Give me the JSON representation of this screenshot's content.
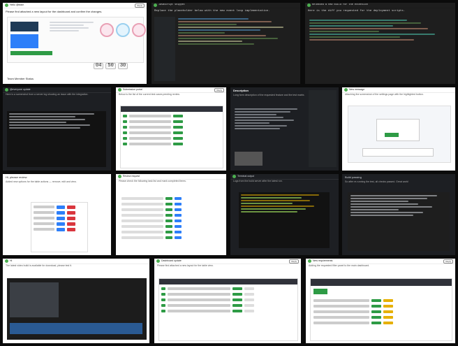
{
  "tiles": [
    {
      "title": "Hello @team",
      "sub": "Please find attached a new layout for the dashboard and confirm the changes."
    },
    {
      "title": "JavaScript snippet",
      "sub": "Replace the placeholder below with the new event loop implementation."
    },
    {
      "title": "Released a new build for the extension",
      "sub": "Here is the diff you requested for the deployment scripts."
    },
    {
      "title": "@everyone update",
      "sub": "Here is a screenshot from a server log showing an issue with the integration."
    },
    {
      "title": "Submission portal",
      "sub": "Below is the list of the current test cases pending review."
    },
    {
      "title": "Description",
      "sub": "Long form description of the requested feature and the test matrix."
    },
    {
      "title": "New message",
      "sub": "Attaching the screenshot of the settings page with the highlighted button."
    },
    {
      "title": "Hi, please review",
      "sub": "Added new options for the table actions — remove, edit and view."
    },
    {
      "title": "Review request",
      "sub": "Please check the following task list and mark completed items."
    },
    {
      "title": "Terminal output",
      "sub": "Logs from the build server after the latest run."
    },
    {
      "title": "Build passing",
      "sub": "So after re-running the test, all checks passed. Great work!"
    },
    {
      "title": "Hi",
      "sub": "The latest video build is available for download, please test it."
    },
    {
      "title": "Dashboard update",
      "sub": "Please find attached a new layout for the table view."
    },
    {
      "title": "New requirements",
      "sub": "Adding the requested filter panel to the main dashboard."
    }
  ],
  "header_btn": "Reply",
  "timer": {
    "h": "04",
    "m": "50",
    "s": "30"
  },
  "tile0_foot": "Team Member Status"
}
